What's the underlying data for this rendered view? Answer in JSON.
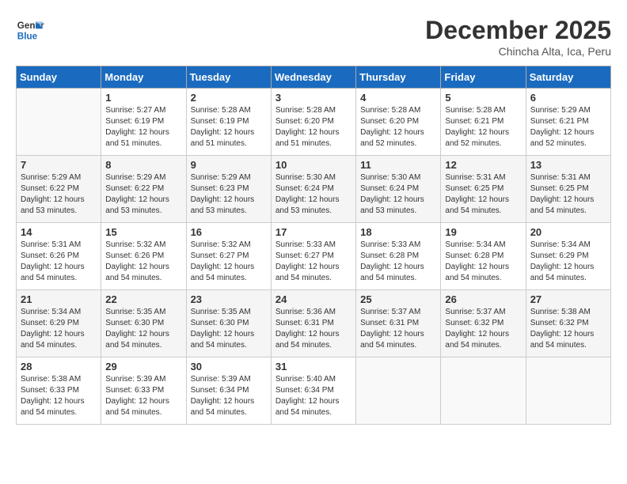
{
  "header": {
    "logo_line1": "General",
    "logo_line2": "Blue",
    "month": "December 2025",
    "location": "Chincha Alta, Ica, Peru"
  },
  "days_of_week": [
    "Sunday",
    "Monday",
    "Tuesday",
    "Wednesday",
    "Thursday",
    "Friday",
    "Saturday"
  ],
  "weeks": [
    [
      {
        "day": "",
        "info": ""
      },
      {
        "day": "1",
        "info": "Sunrise: 5:27 AM\nSunset: 6:19 PM\nDaylight: 12 hours\nand 51 minutes."
      },
      {
        "day": "2",
        "info": "Sunrise: 5:28 AM\nSunset: 6:19 PM\nDaylight: 12 hours\nand 51 minutes."
      },
      {
        "day": "3",
        "info": "Sunrise: 5:28 AM\nSunset: 6:20 PM\nDaylight: 12 hours\nand 51 minutes."
      },
      {
        "day": "4",
        "info": "Sunrise: 5:28 AM\nSunset: 6:20 PM\nDaylight: 12 hours\nand 52 minutes."
      },
      {
        "day": "5",
        "info": "Sunrise: 5:28 AM\nSunset: 6:21 PM\nDaylight: 12 hours\nand 52 minutes."
      },
      {
        "day": "6",
        "info": "Sunrise: 5:29 AM\nSunset: 6:21 PM\nDaylight: 12 hours\nand 52 minutes."
      }
    ],
    [
      {
        "day": "7",
        "info": "Sunrise: 5:29 AM\nSunset: 6:22 PM\nDaylight: 12 hours\nand 53 minutes."
      },
      {
        "day": "8",
        "info": "Sunrise: 5:29 AM\nSunset: 6:22 PM\nDaylight: 12 hours\nand 53 minutes."
      },
      {
        "day": "9",
        "info": "Sunrise: 5:29 AM\nSunset: 6:23 PM\nDaylight: 12 hours\nand 53 minutes."
      },
      {
        "day": "10",
        "info": "Sunrise: 5:30 AM\nSunset: 6:24 PM\nDaylight: 12 hours\nand 53 minutes."
      },
      {
        "day": "11",
        "info": "Sunrise: 5:30 AM\nSunset: 6:24 PM\nDaylight: 12 hours\nand 53 minutes."
      },
      {
        "day": "12",
        "info": "Sunrise: 5:31 AM\nSunset: 6:25 PM\nDaylight: 12 hours\nand 54 minutes."
      },
      {
        "day": "13",
        "info": "Sunrise: 5:31 AM\nSunset: 6:25 PM\nDaylight: 12 hours\nand 54 minutes."
      }
    ],
    [
      {
        "day": "14",
        "info": "Sunrise: 5:31 AM\nSunset: 6:26 PM\nDaylight: 12 hours\nand 54 minutes."
      },
      {
        "day": "15",
        "info": "Sunrise: 5:32 AM\nSunset: 6:26 PM\nDaylight: 12 hours\nand 54 minutes."
      },
      {
        "day": "16",
        "info": "Sunrise: 5:32 AM\nSunset: 6:27 PM\nDaylight: 12 hours\nand 54 minutes."
      },
      {
        "day": "17",
        "info": "Sunrise: 5:33 AM\nSunset: 6:27 PM\nDaylight: 12 hours\nand 54 minutes."
      },
      {
        "day": "18",
        "info": "Sunrise: 5:33 AM\nSunset: 6:28 PM\nDaylight: 12 hours\nand 54 minutes."
      },
      {
        "day": "19",
        "info": "Sunrise: 5:34 AM\nSunset: 6:28 PM\nDaylight: 12 hours\nand 54 minutes."
      },
      {
        "day": "20",
        "info": "Sunrise: 5:34 AM\nSunset: 6:29 PM\nDaylight: 12 hours\nand 54 minutes."
      }
    ],
    [
      {
        "day": "21",
        "info": "Sunrise: 5:34 AM\nSunset: 6:29 PM\nDaylight: 12 hours\nand 54 minutes."
      },
      {
        "day": "22",
        "info": "Sunrise: 5:35 AM\nSunset: 6:30 PM\nDaylight: 12 hours\nand 54 minutes."
      },
      {
        "day": "23",
        "info": "Sunrise: 5:35 AM\nSunset: 6:30 PM\nDaylight: 12 hours\nand 54 minutes."
      },
      {
        "day": "24",
        "info": "Sunrise: 5:36 AM\nSunset: 6:31 PM\nDaylight: 12 hours\nand 54 minutes."
      },
      {
        "day": "25",
        "info": "Sunrise: 5:37 AM\nSunset: 6:31 PM\nDaylight: 12 hours\nand 54 minutes."
      },
      {
        "day": "26",
        "info": "Sunrise: 5:37 AM\nSunset: 6:32 PM\nDaylight: 12 hours\nand 54 minutes."
      },
      {
        "day": "27",
        "info": "Sunrise: 5:38 AM\nSunset: 6:32 PM\nDaylight: 12 hours\nand 54 minutes."
      }
    ],
    [
      {
        "day": "28",
        "info": "Sunrise: 5:38 AM\nSunset: 6:33 PM\nDaylight: 12 hours\nand 54 minutes."
      },
      {
        "day": "29",
        "info": "Sunrise: 5:39 AM\nSunset: 6:33 PM\nDaylight: 12 hours\nand 54 minutes."
      },
      {
        "day": "30",
        "info": "Sunrise: 5:39 AM\nSunset: 6:34 PM\nDaylight: 12 hours\nand 54 minutes."
      },
      {
        "day": "31",
        "info": "Sunrise: 5:40 AM\nSunset: 6:34 PM\nDaylight: 12 hours\nand 54 minutes."
      },
      {
        "day": "",
        "info": ""
      },
      {
        "day": "",
        "info": ""
      },
      {
        "day": "",
        "info": ""
      }
    ]
  ]
}
